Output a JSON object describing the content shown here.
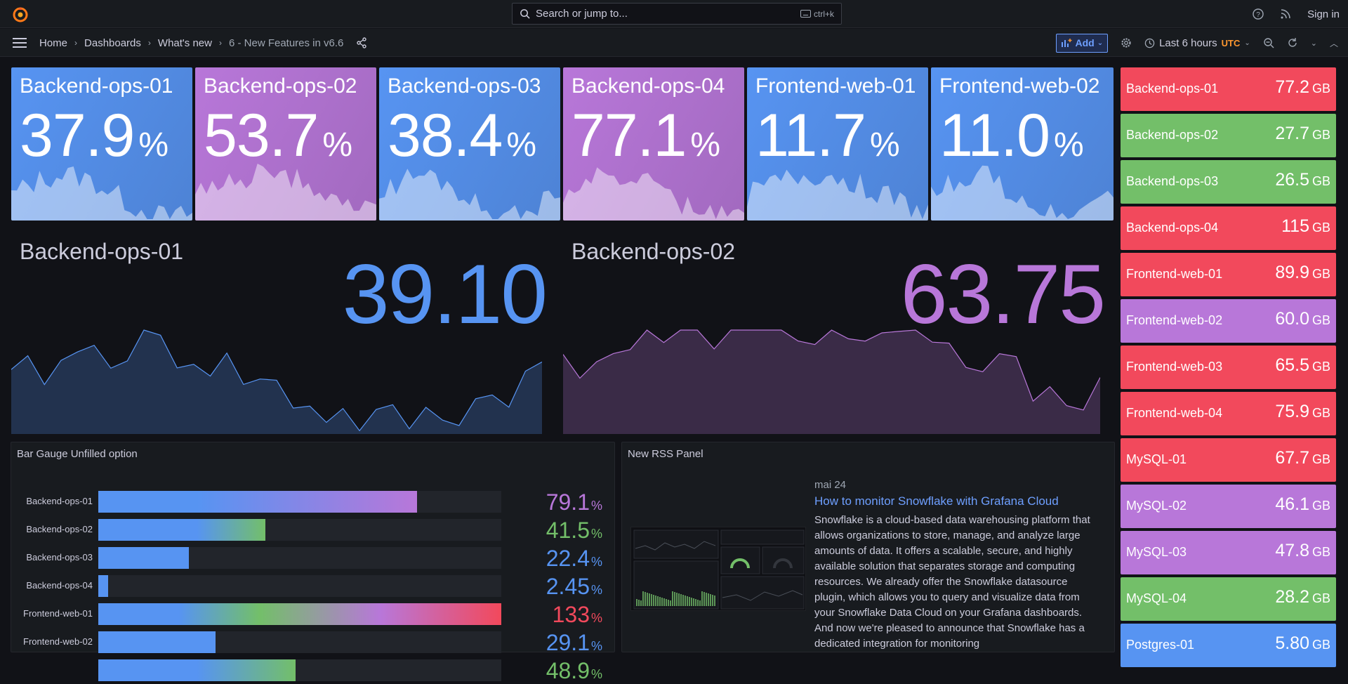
{
  "topbar": {
    "search_placeholder": "Search or jump to...",
    "search_shortcut": "ctrl+k",
    "sign_in": "Sign in"
  },
  "breadcrumbs": [
    "Home",
    "Dashboards",
    "What's new",
    "6 - New Features in v6.6"
  ],
  "toolbar": {
    "add_label": "Add",
    "time_range": "Last 6 hours",
    "timezone": "UTC"
  },
  "colors": {
    "blue": "#5794f2",
    "purple": "#b877d9",
    "green": "#73bf69",
    "red": "#f2495c",
    "orange": "#ff9830"
  },
  "stat_tiles": [
    {
      "name": "Backend-ops-01",
      "value": "37.9",
      "unit": "%",
      "color": "blue"
    },
    {
      "name": "Backend-ops-02",
      "value": "53.7",
      "unit": "%",
      "color": "purple"
    },
    {
      "name": "Backend-ops-03",
      "value": "38.4",
      "unit": "%",
      "color": "blue"
    },
    {
      "name": "Backend-ops-04",
      "value": "77.1",
      "unit": "%",
      "color": "purple"
    },
    {
      "name": "Frontend-web-01",
      "value": "11.7",
      "unit": "%",
      "color": "blue"
    },
    {
      "name": "Frontend-web-02",
      "value": "11.0",
      "unit": "%",
      "color": "blue"
    }
  ],
  "big_stats": [
    {
      "name": "Backend-ops-01",
      "value": "39.10",
      "color": "blue"
    },
    {
      "name": "Backend-ops-02",
      "value": "63.75",
      "color": "purple"
    }
  ],
  "storage_list": [
    {
      "name": "Backend-ops-01",
      "value": "77.2",
      "unit": "GB",
      "color": "red"
    },
    {
      "name": "Backend-ops-02",
      "value": "27.7",
      "unit": "GB",
      "color": "green"
    },
    {
      "name": "Backend-ops-03",
      "value": "26.5",
      "unit": "GB",
      "color": "green"
    },
    {
      "name": "Backend-ops-04",
      "value": "115",
      "unit": "GB",
      "color": "red"
    },
    {
      "name": "Frontend-web-01",
      "value": "89.9",
      "unit": "GB",
      "color": "red"
    },
    {
      "name": "Frontend-web-02",
      "value": "60.0",
      "unit": "GB",
      "color": "purple"
    },
    {
      "name": "Frontend-web-03",
      "value": "65.5",
      "unit": "GB",
      "color": "red"
    },
    {
      "name": "Frontend-web-04",
      "value": "75.9",
      "unit": "GB",
      "color": "red"
    },
    {
      "name": "MySQL-01",
      "value": "67.7",
      "unit": "GB",
      "color": "red"
    },
    {
      "name": "MySQL-02",
      "value": "46.1",
      "unit": "GB",
      "color": "purple"
    },
    {
      "name": "MySQL-03",
      "value": "47.8",
      "unit": "GB",
      "color": "purple"
    },
    {
      "name": "MySQL-04",
      "value": "28.2",
      "unit": "GB",
      "color": "green"
    },
    {
      "name": "Postgres-01",
      "value": "5.80",
      "unit": "GB",
      "color": "blue"
    }
  ],
  "bar_gauge": {
    "title": "Bar Gauge Unfilled option",
    "rows": [
      {
        "name": "Backend-ops-01",
        "value": "79.1",
        "unit": "%",
        "level": 0.791,
        "color": "purple"
      },
      {
        "name": "Backend-ops-02",
        "value": "41.5",
        "unit": "%",
        "level": 0.415,
        "color": "green"
      },
      {
        "name": "Backend-ops-03",
        "value": "22.4",
        "unit": "%",
        "level": 0.224,
        "color": "blue"
      },
      {
        "name": "Backend-ops-04",
        "value": "2.45",
        "unit": "%",
        "level": 0.0245,
        "color": "blue"
      },
      {
        "name": "Frontend-web-01",
        "value": "133",
        "unit": "%",
        "level": 1.0,
        "color": "red"
      },
      {
        "name": "Frontend-web-02",
        "value": "29.1",
        "unit": "%",
        "level": 0.291,
        "color": "blue"
      },
      {
        "name": "",
        "value": "48.9",
        "unit": "%",
        "level": 0.489,
        "color": "green"
      }
    ]
  },
  "rss": {
    "title": "New RSS Panel",
    "date": "mai 24",
    "headline": "How to monitor Snowflake with Grafana Cloud",
    "body": "Snowflake is a cloud-based data warehousing platform that allows organizations to store, manage, and analyze large amounts of data. It offers a scalable, secure, and highly available solution that separates storage and computing resources. We already offer the Snowflake datasource plugin, which allows you to query and visualize data from your Snowflake Data Cloud on your Grafana dashboards. And now we're pleased to announce that Snowflake has a dedicated integration for monitoring"
  }
}
